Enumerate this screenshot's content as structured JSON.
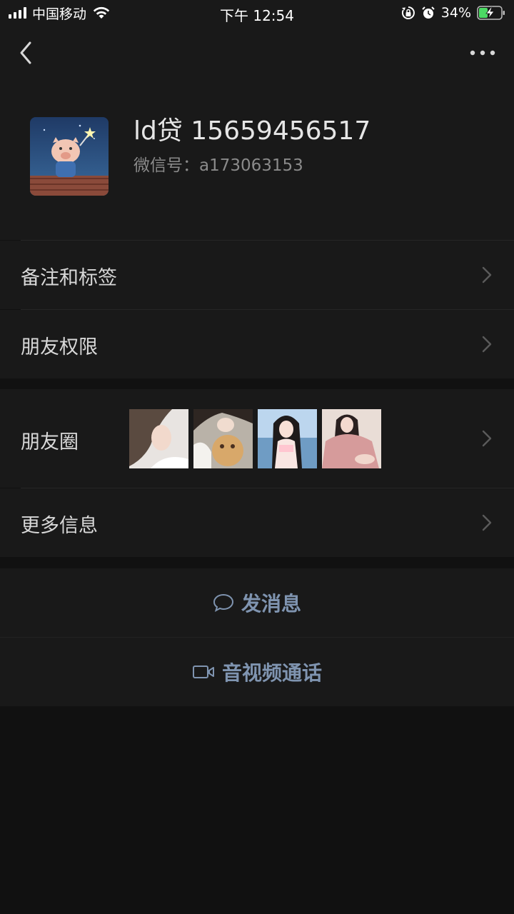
{
  "status_bar": {
    "carrier": "中国移动",
    "time": "下午 12:54",
    "battery_percent": "34%",
    "icons": [
      "signal-icon",
      "wifi-icon",
      "orientation-lock-icon",
      "alarm-icon",
      "battery-charging-icon"
    ]
  },
  "nav": {
    "back_icon": "chevron-left-icon",
    "more_icon": "more-dots-icon"
  },
  "profile": {
    "name": "ld贷 15659456517",
    "wechat_id": "微信号：a173063153",
    "avatar": "avatar-pig-icon"
  },
  "cells": {
    "remarks_tags": "备注和标签",
    "friend_permissions": "朋友权限",
    "moments": "朋友圈",
    "more_info": "更多信息"
  },
  "moments_photos": [
    "photo-1",
    "photo-2",
    "photo-3",
    "photo-4"
  ],
  "actions": {
    "send_message": "发消息",
    "av_call": "音视频通话"
  },
  "colors": {
    "background": "#111111",
    "cell_background": "#191919",
    "action_text": "#7f94b0",
    "secondary_text": "#8a8a8a"
  }
}
